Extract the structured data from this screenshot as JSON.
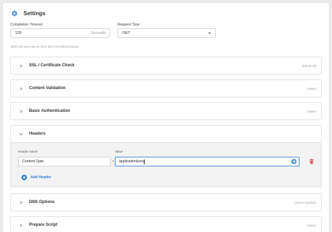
{
  "settings": {
    "title": "Settings",
    "colors": {
      "accent": "#2f80d3",
      "danger": "#e05a5a"
    }
  },
  "completion_timeout": {
    "label": "Completion Timeout",
    "value": "120",
    "unit": "Seconds",
    "hint": "Tasks will generate an error after exceeding timeout."
  },
  "request_type": {
    "label": "Request Type",
    "value": "GET"
  },
  "sections": [
    {
      "title": "SSL / Certificate Check",
      "status": "(Check All)",
      "expanded": false
    },
    {
      "title": "Content Validation",
      "status": "(None)",
      "expanded": false
    },
    {
      "title": "Basic Authentication",
      "status": "(None)",
      "expanded": false
    },
    {
      "title": "Headers",
      "status": "",
      "expanded": true
    },
    {
      "title": "DNS Options",
      "status": "(Server Cached)",
      "expanded": false
    },
    {
      "title": "Prepare Script",
      "status": "(None)",
      "expanded": false
    }
  ],
  "headers": {
    "name_label": "Header Name",
    "value_label": "Value",
    "rows": [
      {
        "name": "Content-Type",
        "separator": "=",
        "value": "application/json"
      }
    ],
    "add_label": "Add Header"
  },
  "icons": {
    "title": "gear-icon",
    "collapsed": "chevron-right-icon",
    "expanded": "chevron-down-icon",
    "value_options": "gear-icon",
    "remove": "trash-icon",
    "add": "plus-circle-icon"
  }
}
